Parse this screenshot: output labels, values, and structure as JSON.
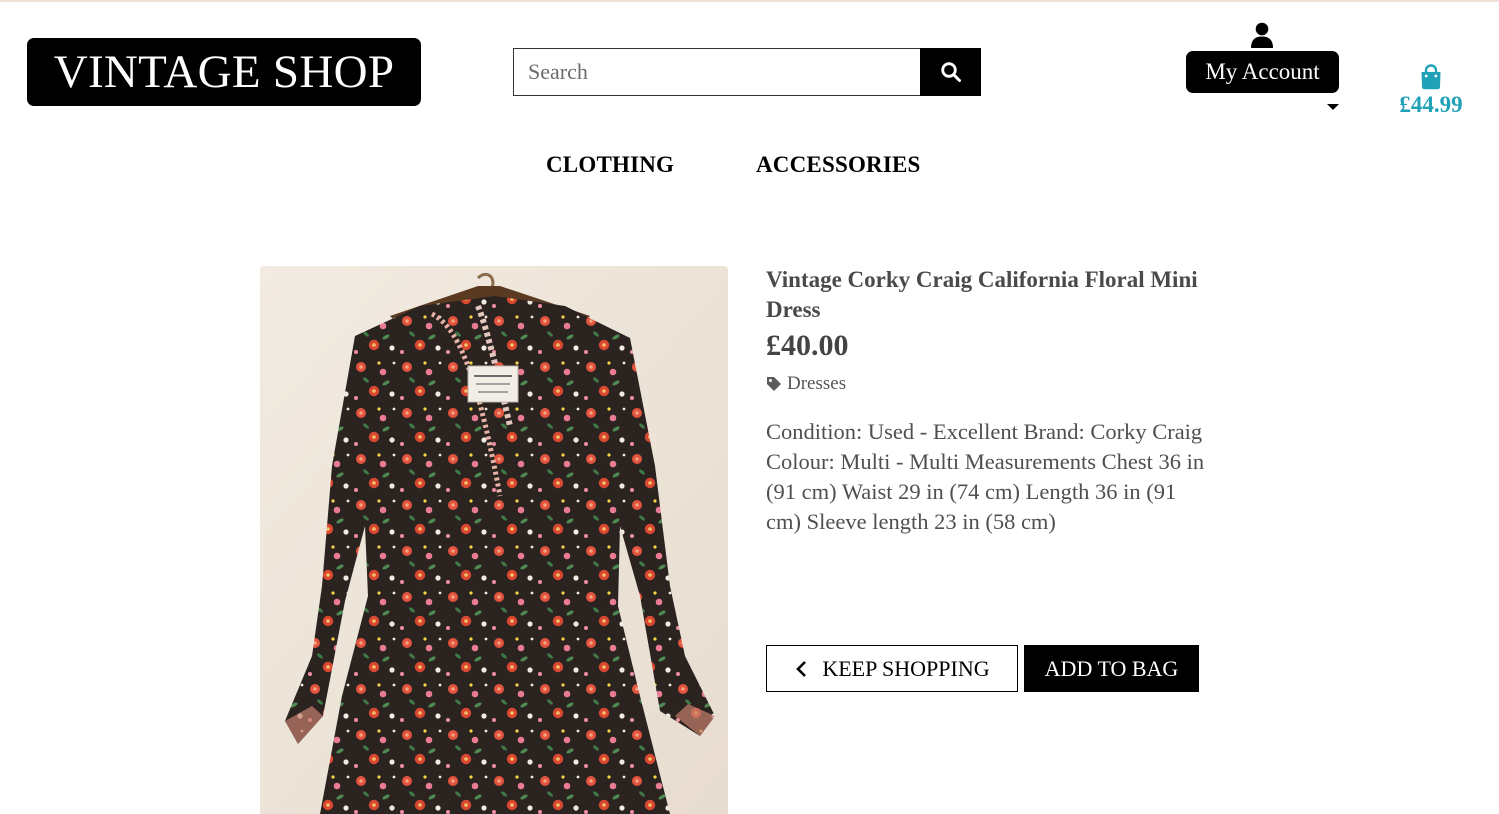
{
  "header": {
    "logo": "VINTAGE SHOP",
    "search": {
      "placeholder": "Search",
      "value": "",
      "icon": "search-icon"
    },
    "account": {
      "label": "My Account",
      "icon": "person-icon"
    },
    "bag": {
      "total": "£44.99",
      "icon": "shopping-bag-icon"
    }
  },
  "nav": {
    "items": [
      {
        "label": "CLOTHING"
      },
      {
        "label": "ACCESSORIES"
      }
    ]
  },
  "product": {
    "title": "Vintage Corky Craig California Floral Mini Dress",
    "price": "£40.00",
    "category": "Dresses",
    "description": "Condition: Used - Excellent Brand: Corky Craig Colour: Multi - Multi Measurements Chest 36 in (91 cm) Waist 29 in (74 cm) Length 36 in (91 cm) Sleeve length 23 in (58 cm)"
  },
  "actions": {
    "keep_shopping": "KEEP SHOPPING",
    "add_to_bag": "ADD TO BAG"
  },
  "colors": {
    "accent": "#1fa1b8",
    "primary": "#000000",
    "text": "#4a4a4a"
  }
}
